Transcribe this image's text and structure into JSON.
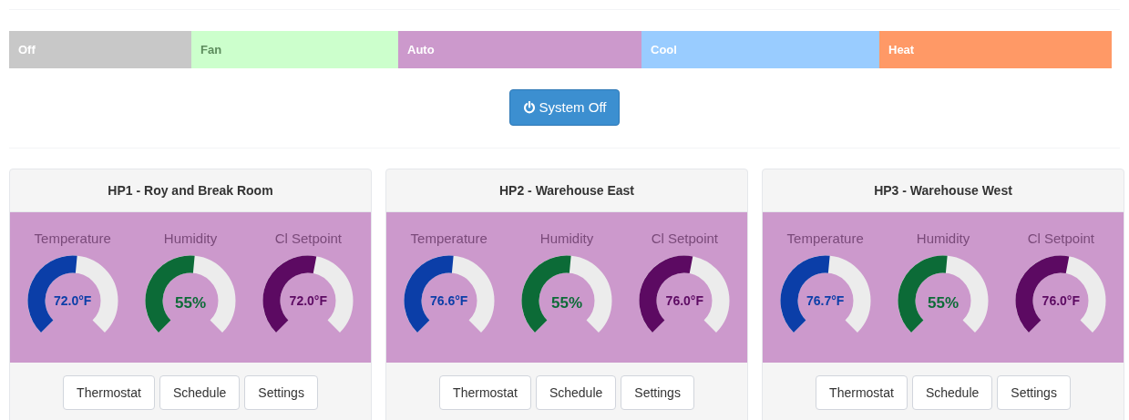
{
  "modes": [
    {
      "label": "Off",
      "color": "#c8c8c8"
    },
    {
      "label": "Fan",
      "color": "#ccffcc"
    },
    {
      "label": "Auto",
      "color": "#cc99cc"
    },
    {
      "label": "Cool",
      "color": "#99ccff"
    },
    {
      "label": "Heat",
      "color": "#ff9966"
    }
  ],
  "system_button": {
    "label": "System Off"
  },
  "units": [
    {
      "title": "HP1 - Roy and Break Room",
      "gauges": [
        {
          "kind": "temperature",
          "label": "Temperature",
          "value": "72.0°F"
        },
        {
          "kind": "humidity",
          "label": "Humidity",
          "value": "55%"
        },
        {
          "kind": "setpoint",
          "label": "Cl Setpoint",
          "value": "72.0°F"
        }
      ],
      "buttons": [
        "Thermostat",
        "Schedule",
        "Settings"
      ]
    },
    {
      "title": "HP2 - Warehouse East",
      "gauges": [
        {
          "kind": "temperature",
          "label": "Temperature",
          "value": "76.6°F"
        },
        {
          "kind": "humidity",
          "label": "Humidity",
          "value": "55%"
        },
        {
          "kind": "setpoint",
          "label": "Cl Setpoint",
          "value": "76.0°F"
        }
      ],
      "buttons": [
        "Thermostat",
        "Schedule",
        "Settings"
      ]
    },
    {
      "title": "HP3 - Warehouse West",
      "gauges": [
        {
          "kind": "temperature",
          "label": "Temperature",
          "value": "76.7°F"
        },
        {
          "kind": "humidity",
          "label": "Humidity",
          "value": "55%"
        },
        {
          "kind": "setpoint",
          "label": "Cl Setpoint",
          "value": "76.0°F"
        }
      ],
      "buttons": [
        "Thermostat",
        "Schedule",
        "Settings"
      ]
    }
  ]
}
